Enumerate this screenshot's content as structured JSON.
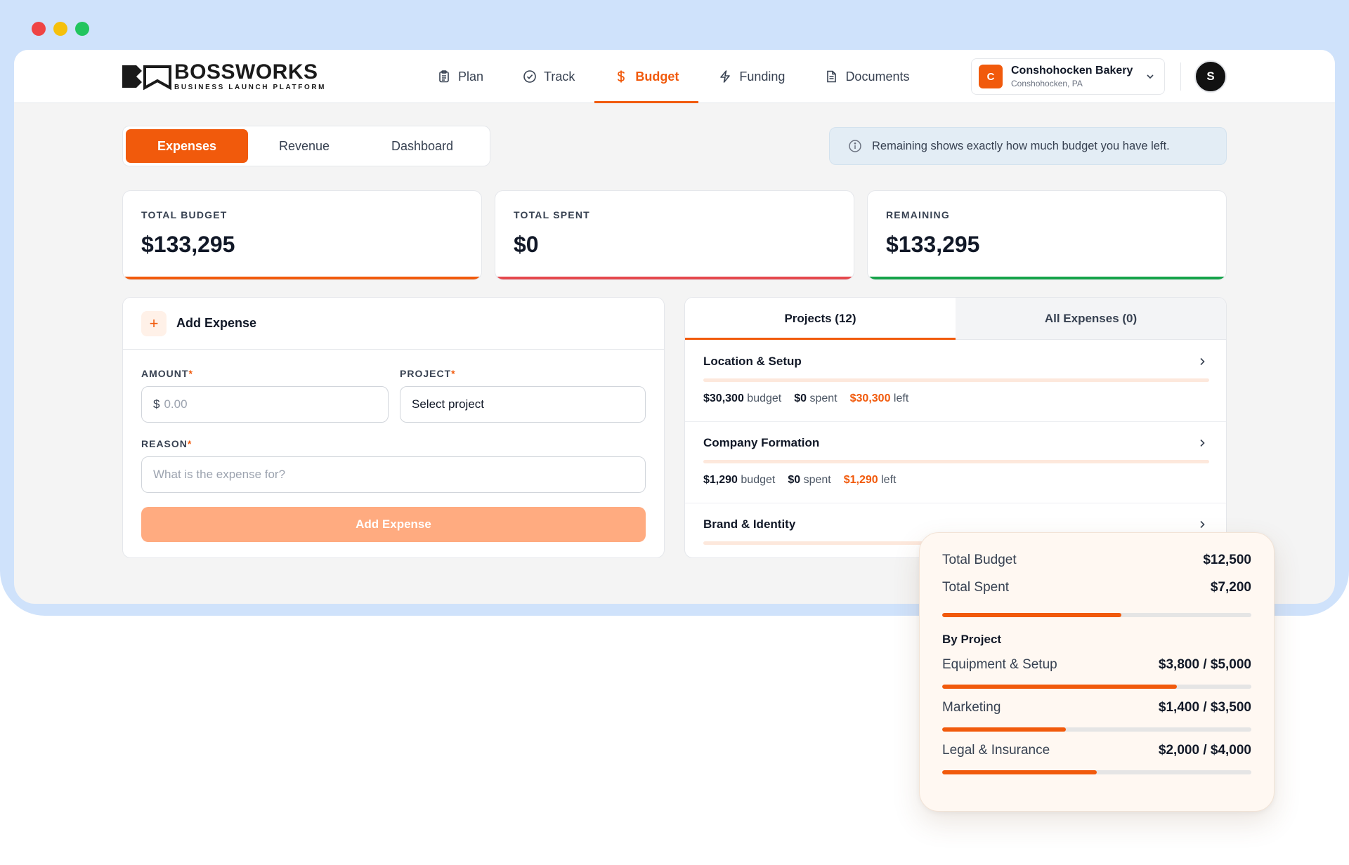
{
  "brand": {
    "name": "BOSSWORKS",
    "tagline": "BUSINESS LAUNCH PLATFORM"
  },
  "nav": {
    "items": [
      {
        "label": "Plan",
        "icon": "clipboard-icon",
        "active": false
      },
      {
        "label": "Track",
        "icon": "check-circle-icon",
        "active": false
      },
      {
        "label": "Budget",
        "icon": "dollar-icon",
        "active": true
      },
      {
        "label": "Funding",
        "icon": "lightning-icon",
        "active": false
      },
      {
        "label": "Documents",
        "icon": "document-icon",
        "active": false
      }
    ]
  },
  "company": {
    "initial": "C",
    "name": "Conshohocken Bakery",
    "location": "Conshohocken, PA"
  },
  "user": {
    "initial": "S"
  },
  "tabs": {
    "expenses": "Expenses",
    "revenue": "Revenue",
    "dashboard": "Dashboard"
  },
  "info": {
    "text": "Remaining shows exactly how much budget you have left."
  },
  "stats": {
    "total_budget": {
      "label": "TOTAL BUDGET",
      "value": "$133,295"
    },
    "total_spent": {
      "label": "TOTAL SPENT",
      "value": "$0"
    },
    "remaining": {
      "label": "REMAINING",
      "value": "$133,295"
    }
  },
  "form": {
    "title": "Add Expense",
    "amount_label": "AMOUNT",
    "amount_currency": "$",
    "amount_placeholder": "0.00",
    "project_label": "PROJECT",
    "project_value": "Select project",
    "reason_label": "REASON",
    "reason_placeholder": "What is the expense for?",
    "required_mark": "*",
    "submit": "Add Expense"
  },
  "panel": {
    "tab_projects": "Projects (12)",
    "tab_all": "All Expenses (0)",
    "rows": [
      {
        "title": "Location & Setup",
        "budget": "$30,300",
        "budget_word": "budget",
        "spent": "$0",
        "spent_word": "spent",
        "left": "$30,300",
        "left_word": "left"
      },
      {
        "title": "Company Formation",
        "budget": "$1,290",
        "budget_word": "budget",
        "spent": "$0",
        "spent_word": "spent",
        "left": "$1,290",
        "left_word": "left"
      },
      {
        "title": "Brand & Identity"
      }
    ]
  },
  "summary": {
    "total_budget_label": "Total Budget",
    "total_budget_value": "$12,500",
    "total_spent_label": "Total Spent",
    "total_spent_value": "$7,200",
    "spent_fraction": 0.58,
    "by_project_label": "By Project",
    "projects": [
      {
        "name": "Equipment & Setup",
        "value": "$3,800 / $5,000",
        "fraction": 0.76
      },
      {
        "name": "Marketing",
        "value": "$1,400 / $3,500",
        "fraction": 0.4
      },
      {
        "name": "Legal & Insurance",
        "value": "$2,000 / $4,000",
        "fraction": 0.5
      }
    ]
  },
  "colors": {
    "accent": "#f15a0c",
    "spent_bar": "#e5484d",
    "remaining_bar": "#16a34a",
    "frame": "#cfe2fb"
  }
}
